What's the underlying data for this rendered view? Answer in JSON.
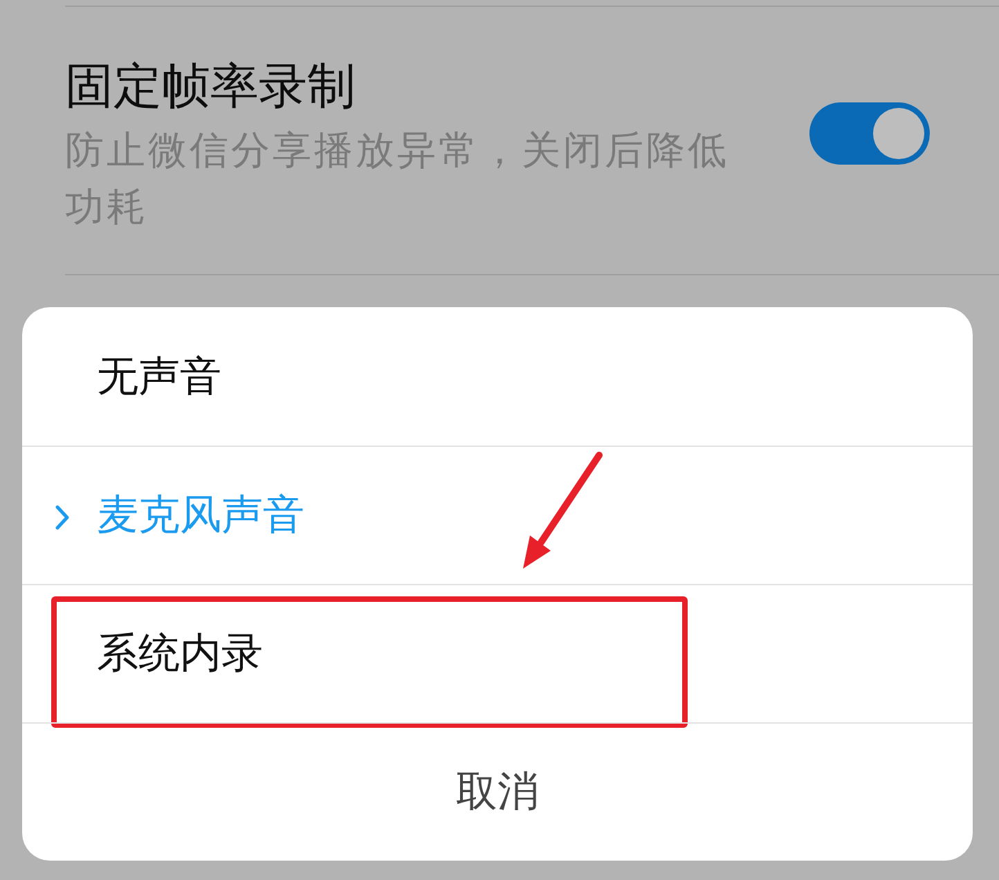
{
  "setting": {
    "title": "固定帧率录制",
    "description": "防止微信分享播放异常，关闭后降低功耗",
    "on": true
  },
  "sheet": {
    "options": [
      {
        "label": "无声音",
        "selected": false,
        "highlighted": false
      },
      {
        "label": "麦克风声音",
        "selected": true,
        "highlighted": false
      },
      {
        "label": "系统内录",
        "selected": false,
        "highlighted": true
      }
    ],
    "cancel": "取消"
  }
}
